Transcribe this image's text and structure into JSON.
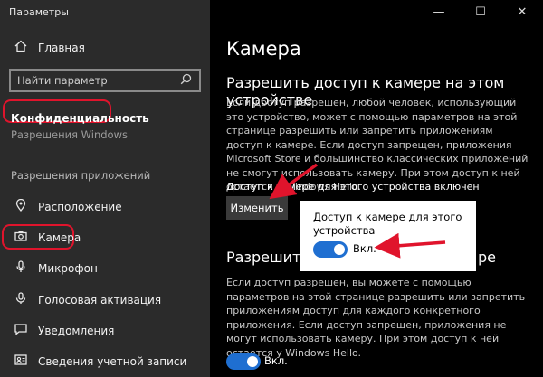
{
  "window": {
    "title": "Параметры",
    "minimize_glyph": "—",
    "maximize_glyph": "☐",
    "close_glyph": "✕"
  },
  "sidebar": {
    "home_label": "Главная",
    "search_placeholder": "Найти параметр",
    "privacy_label": "Конфиденциальность",
    "faded_label": "Разрешения Windows",
    "section_header": "Разрешения приложений",
    "items": [
      {
        "label": "Расположение",
        "icon": "location-icon"
      },
      {
        "label": "Камера",
        "icon": "camera-icon"
      },
      {
        "label": "Микрофон",
        "icon": "microphone-icon"
      },
      {
        "label": "Голосовая активация",
        "icon": "voice-activation-icon"
      },
      {
        "label": "Уведомления",
        "icon": "notifications-icon"
      },
      {
        "label": "Сведения учетной записи",
        "icon": "account-info-icon"
      }
    ]
  },
  "main": {
    "title": "Камера",
    "section1": {
      "heading": "Разрешить доступ к камере на этом устройстве",
      "description": "Если доступ разрешен, любой человек, использующий это устройство, может с помощью параметров на этой странице разрешить или запретить приложениям доступ к камере. Если доступ запрещен, приложения Microsoft Store и большинство классических приложений не смогут использовать камеру. При этом доступ к ней остается у Windows Hello.",
      "status": "Доступ к камере для этого устройства включен",
      "change_button": "Изменить"
    },
    "section2": {
      "heading_left": "Разрешить г",
      "heading_right": "ре",
      "description": "Если доступ разрешен, вы можете с помощью параметров на этой странице разрешить или запретить приложениям доступ для каждого конкретного приложения. Если доступ запрещен, приложения не могут использовать камеру. При этом доступ к ней остается у Windows Hello.",
      "toggle_label": "Вкл.",
      "toggle_on": true
    }
  },
  "popup": {
    "title": "Доступ к камере для этого устройства",
    "toggle_label": "Вкл.",
    "toggle_on": true
  },
  "colors": {
    "accent": "#1f6fd1",
    "annotation_red": "#e0142c",
    "sidebar_bg": "#2b2b2b",
    "content_bg": "#000000"
  }
}
